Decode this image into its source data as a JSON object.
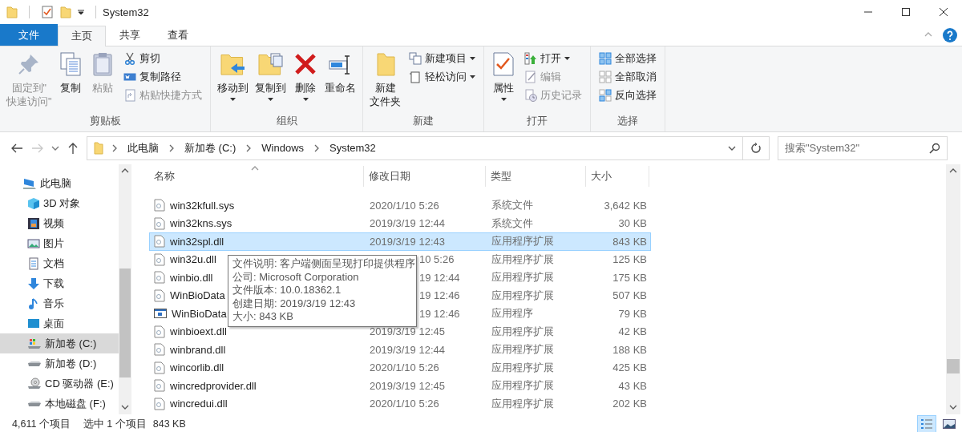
{
  "title_bar": {
    "title": "System32"
  },
  "ribbon": {
    "tabs": [
      {
        "label": "文件",
        "kind": "file",
        "selected": false
      },
      {
        "label": "主页",
        "kind": "tab",
        "selected": true
      },
      {
        "label": "共享",
        "kind": "tab",
        "selected": false
      },
      {
        "label": "查看",
        "kind": "tab",
        "selected": false
      }
    ],
    "groups": [
      {
        "label": "剪贴板",
        "items": [
          {
            "lines": [
              "固定到\"",
              "快速访问\""
            ],
            "kind": "large",
            "disabled": true,
            "has_menu": false
          },
          {
            "label": "复制",
            "kind": "large",
            "disabled": false,
            "has_menu": false
          },
          {
            "label": "粘贴",
            "kind": "large",
            "disabled": true,
            "has_menu": false
          },
          {
            "label": "剪切",
            "kind": "small",
            "disabled": false,
            "has_menu": false
          },
          {
            "label": "复制路径",
            "kind": "small",
            "disabled": false,
            "has_menu": false
          },
          {
            "label": "粘贴快捷方式",
            "kind": "small",
            "disabled": true,
            "has_menu": false
          }
        ]
      },
      {
        "label": "组织",
        "items": [
          {
            "label": "移动到",
            "kind": "large",
            "disabled": false,
            "has_menu": true
          },
          {
            "label": "复制到",
            "kind": "large",
            "disabled": false,
            "has_menu": true
          },
          {
            "label": "删除",
            "kind": "large",
            "disabled": false,
            "has_menu": true
          },
          {
            "label": "重命名",
            "kind": "large",
            "disabled": false,
            "has_menu": false
          }
        ]
      },
      {
        "label": "新建",
        "items": [
          {
            "lines": [
              "新建",
              "文件夹"
            ],
            "kind": "large",
            "disabled": false,
            "has_menu": false
          },
          {
            "label": "新建项目",
            "kind": "small",
            "disabled": false,
            "has_menu": true
          },
          {
            "label": "轻松访问",
            "kind": "small",
            "disabled": false,
            "has_menu": true
          }
        ]
      },
      {
        "label": "打开",
        "items": [
          {
            "label": "属性",
            "kind": "large",
            "disabled": false,
            "has_menu": true
          },
          {
            "label": "打开",
            "kind": "small",
            "disabled": false,
            "has_menu": true
          },
          {
            "label": "编辑",
            "kind": "small",
            "disabled": true,
            "has_menu": false
          },
          {
            "label": "历史记录",
            "kind": "small",
            "disabled": true,
            "has_menu": false
          }
        ]
      },
      {
        "label": "选择",
        "items": [
          {
            "label": "全部选择",
            "kind": "small",
            "disabled": false,
            "has_menu": false
          },
          {
            "label": "全部取消",
            "kind": "small",
            "disabled": false,
            "has_menu": false
          },
          {
            "label": "反向选择",
            "kind": "small",
            "disabled": false,
            "has_menu": false
          }
        ]
      }
    ]
  },
  "address_bar": {
    "back_disabled": false,
    "forward_disabled": true,
    "breadcrumbs": [
      "此电脑",
      "新加卷 (C:)",
      "Windows",
      "System32"
    ]
  },
  "search": {
    "placeholder": "搜索\"System32\""
  },
  "navigation": {
    "items": [
      {
        "label": "此电脑",
        "selected": false,
        "children": [
          {
            "label": "3D 对象",
            "selected": false
          },
          {
            "label": "视频",
            "selected": false
          },
          {
            "label": "图片",
            "selected": false
          },
          {
            "label": "文档",
            "selected": false
          },
          {
            "label": "下载",
            "selected": false
          },
          {
            "label": "音乐",
            "selected": false
          },
          {
            "label": "桌面",
            "selected": false
          },
          {
            "label": "新加卷 (C:)",
            "selected": true
          },
          {
            "label": "新加卷 (D:)",
            "selected": false
          },
          {
            "label": "CD 驱动器 (E:)",
            "selected": false
          },
          {
            "label": "本地磁盘 (F:)",
            "selected": false
          }
        ]
      }
    ]
  },
  "file_list": {
    "columns": [
      {
        "label": "名称",
        "sorted": true
      },
      {
        "label": "修改日期",
        "sorted": false
      },
      {
        "label": "类型",
        "sorted": false
      },
      {
        "label": "大小",
        "sorted": false
      }
    ],
    "rows": [
      {
        "name": "win32kfull.sys",
        "date": "2020/1/10 5:26",
        "type": "系统文件",
        "size": "3,642 KB",
        "kind": "file",
        "selected": false
      },
      {
        "name": "win32kns.sys",
        "date": "2019/3/19 12:44",
        "type": "系统文件",
        "size": "30 KB",
        "kind": "file",
        "selected": false
      },
      {
        "name": "win32spl.dll",
        "date": "2019/3/19 12:43",
        "type": "应用程序扩展",
        "size": "843 KB",
        "kind": "file",
        "selected": true
      },
      {
        "name": "win32u.dll",
        "date_tail": "10 5:26",
        "type": "应用程序扩展",
        "size": "125 KB",
        "kind": "file",
        "selected": false
      },
      {
        "name": "winbio.dll",
        "date_tail": "19 12:44",
        "type": "应用程序扩展",
        "size": "175 KB",
        "kind": "file",
        "selected": false
      },
      {
        "name": "WinBioData",
        "date_tail": "19 12:46",
        "type": "应用程序扩展",
        "size": "507 KB",
        "kind": "file",
        "selected": false
      },
      {
        "name": "WinBioData",
        "date_tail": "19 12:46",
        "type": "应用程序",
        "size": "79 KB",
        "kind": "app",
        "selected": false
      },
      {
        "name": "winbioext.dll",
        "date": "2019/3/19 12:45",
        "type": "应用程序扩展",
        "size": "42 KB",
        "kind": "file",
        "selected": false
      },
      {
        "name": "winbrand.dll",
        "date": "2019/3/19 12:44",
        "type": "应用程序扩展",
        "size": "188 KB",
        "kind": "file",
        "selected": false
      },
      {
        "name": "wincorlib.dll",
        "date": "2020/1/10 5:26",
        "type": "应用程序扩展",
        "size": "425 KB",
        "kind": "file",
        "selected": false
      },
      {
        "name": "wincredprovider.dll",
        "date": "2019/3/19 12:45",
        "type": "应用程序扩展",
        "size": "43 KB",
        "kind": "file",
        "selected": false
      },
      {
        "name": "wincredui.dll",
        "date": "2020/1/10 5:26",
        "type": "应用程序扩展",
        "size": "202 KB",
        "kind": "file",
        "selected": false
      }
    ]
  },
  "tooltip": {
    "lines": [
      "文件说明: 客户端侧面呈现打印提供程序",
      "公司: Microsoft Corporation",
      "文件版本: 10.0.18362.1",
      "创建日期: 2019/3/19 12:43",
      "大小: 843 KB"
    ]
  },
  "status_bar": {
    "item_count": "4,611 个项目",
    "selection": "选中 1 个项目",
    "selection_size": "843 KB",
    "views": [
      {
        "kind": "details",
        "selected": true
      },
      {
        "kind": "large_icons",
        "selected": false
      }
    ]
  }
}
